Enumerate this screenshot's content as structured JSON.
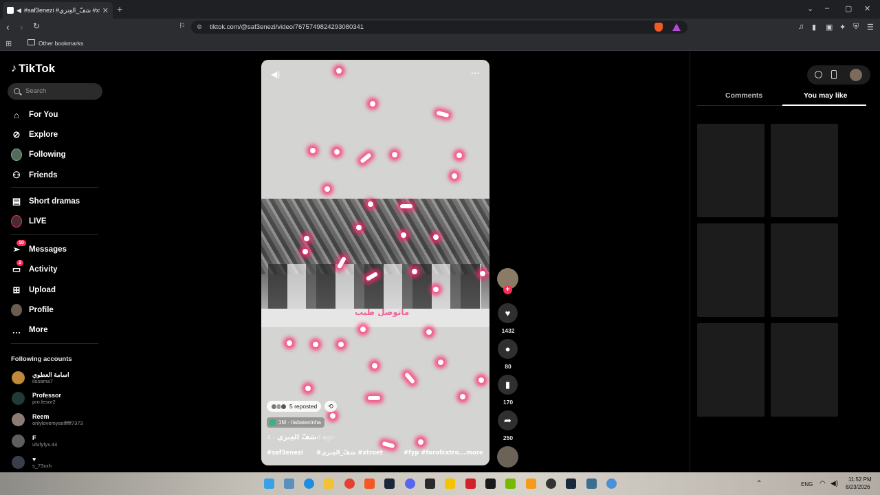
{
  "browser": {
    "tab_title": "#saf3enezi #سَفّ_العِنزي #xtro",
    "url": "tiktok.com/@saf3enezi/video/7675749824293080341",
    "bookmark_folder": "Other bookmarks"
  },
  "sidebar": {
    "logo": "TikTok",
    "search_placeholder": "Search",
    "items": [
      {
        "label": "For You",
        "icon": "home-icon"
      },
      {
        "label": "Explore",
        "icon": "compass-icon"
      },
      {
        "label": "Following",
        "icon": "avatar-icon"
      },
      {
        "label": "Friends",
        "icon": "friends-icon"
      },
      {
        "label": "Short dramas",
        "icon": "film-icon"
      },
      {
        "label": "LIVE",
        "icon": "live-icon"
      },
      {
        "label": "Messages",
        "icon": "message-icon",
        "badge": "10"
      },
      {
        "label": "Activity",
        "icon": "activity-icon",
        "badge": "2"
      },
      {
        "label": "Upload",
        "icon": "upload-icon"
      },
      {
        "label": "Profile",
        "icon": "profile-icon"
      },
      {
        "label": "More",
        "icon": "more-icon"
      }
    ],
    "following_title": "Following accounts",
    "accounts": [
      {
        "name": "اسامة العطوي",
        "handle": "ilosama7"
      },
      {
        "name": "Professor",
        "handle": "pro.fesor2"
      },
      {
        "name": "Reem",
        "handle": "onlylovemyselfffff7373"
      },
      {
        "name": "F",
        "handle": "ufufyfyx.44"
      },
      {
        "name": "♥",
        "handle": "s_73xxh"
      }
    ]
  },
  "video": {
    "caption_overlay": "ماتوصل طيب",
    "reposted": "5 reposted",
    "music": "1M · Itabaianinha",
    "author": "سَفّ العِنزي",
    "ago": "· 4d ago",
    "tags": [
      "#saf3enezi",
      "#سَفّ_العِنزي #xtroet",
      "#fyp #forofcxtro..."
    ],
    "more": "more"
  },
  "actions": {
    "likes": "1432",
    "comments": "80",
    "saves": "170",
    "shares": "250"
  },
  "right_panel": {
    "tab_comments": "Comments",
    "tab_you_may_like": "You may like"
  },
  "taskbar": {
    "lang": "ENG",
    "time": "11:52 PM",
    "date": "8/23/2026"
  },
  "colors": {
    "accent": "#fe2c55",
    "bg": "#000000"
  }
}
